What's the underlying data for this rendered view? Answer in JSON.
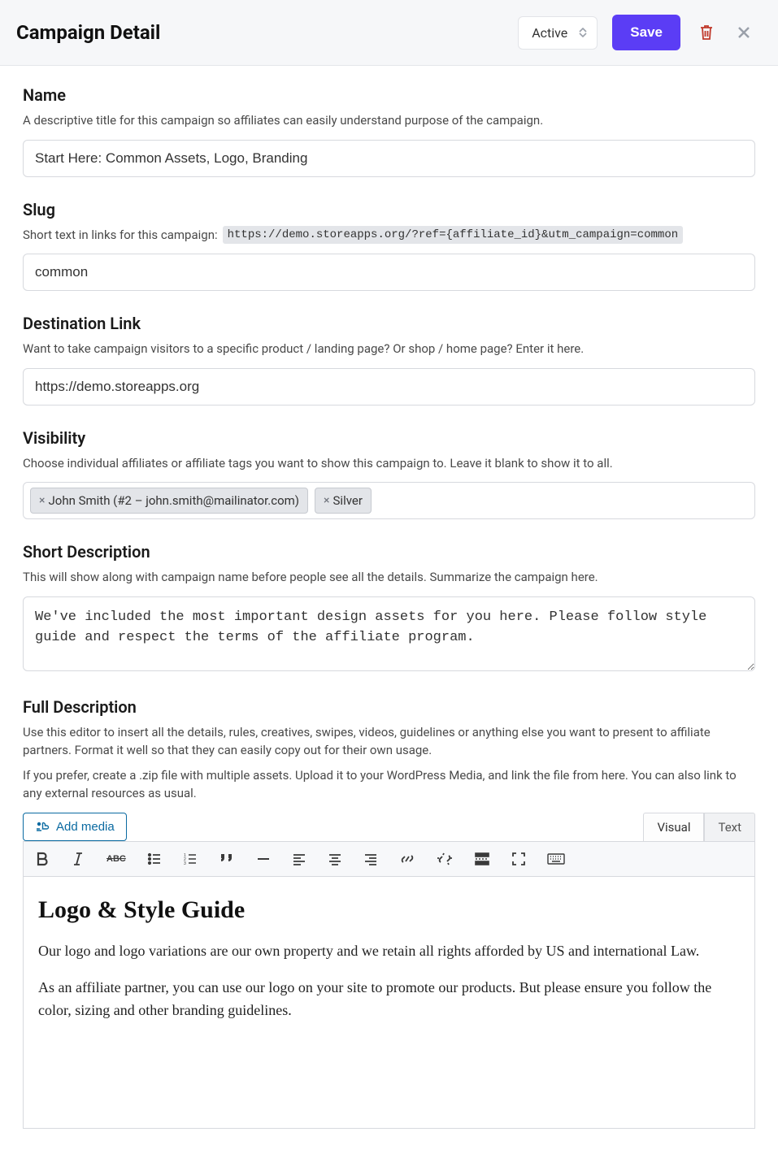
{
  "header": {
    "title": "Campaign Detail",
    "status_value": "Active",
    "save_label": "Save"
  },
  "name": {
    "label": "Name",
    "help": "A descriptive title for this campaign so affiliates can easily understand purpose of the campaign.",
    "value": "Start Here: Common Assets, Logo, Branding"
  },
  "slug": {
    "label": "Slug",
    "help_prefix": "Short text in links for this campaign:",
    "url_example": "https://demo.storeapps.org/?ref={affiliate_id}&utm_campaign=common",
    "value": "common"
  },
  "destination": {
    "label": "Destination Link",
    "help": "Want to take campaign visitors to a specific product / landing page? Or shop / home page? Enter it here.",
    "value": "https://demo.storeapps.org"
  },
  "visibility": {
    "label": "Visibility",
    "help": "Choose individual affiliates or affiliate tags you want to show this campaign to. Leave it blank to show it to all.",
    "tags": [
      "John Smith (#2 – john.smith@mailinator.com)",
      "Silver"
    ]
  },
  "short_desc": {
    "label": "Short Description",
    "help": "This will show along with campaign name before people see all the details. Summarize the campaign here.",
    "value": "We've included the most important design assets for you here. Please follow style guide and respect the terms of the affiliate program."
  },
  "full_desc": {
    "label": "Full Description",
    "help1": "Use this editor to insert all the details, rules, creatives, swipes, videos, guidelines or anything else you want to present to affiliate partners. Format it well so that they can easily copy out for their own usage.",
    "help2": "If you prefer, create a .zip file with multiple assets. Upload it to your WordPress Media, and link the file from here. You can also link to any external resources as usual.",
    "add_media_label": "Add media",
    "tab_visual": "Visual",
    "tab_text": "Text",
    "content_heading": "Logo & Style Guide",
    "content_p1": "Our logo and logo variations are our own property and we retain all rights afforded by US and international Law.",
    "content_p2": "As an affiliate partner, you can use our logo on your site to promote our products. But please ensure you follow the color, sizing and other branding guidelines."
  }
}
